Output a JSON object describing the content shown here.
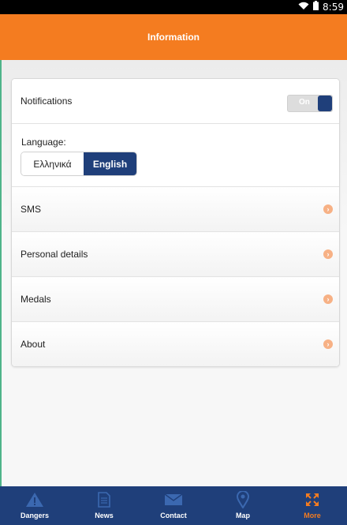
{
  "status_bar": {
    "time": "8:59"
  },
  "header": {
    "title": "Information"
  },
  "settings": {
    "notifications": {
      "label": "Notifications",
      "toggle_text": "On"
    },
    "language": {
      "label": "Language:",
      "options": [
        "Ελληνικά",
        "English"
      ],
      "selected": "English"
    },
    "menu_items": [
      {
        "label": "SMS"
      },
      {
        "label": "Personal details"
      },
      {
        "label": "Medals"
      },
      {
        "label": "About"
      }
    ]
  },
  "bottom_nav": {
    "items": [
      {
        "label": "Dangers",
        "icon": "warning-icon"
      },
      {
        "label": "News",
        "icon": "document-icon"
      },
      {
        "label": "Contact",
        "icon": "envelope-icon"
      },
      {
        "label": "Map",
        "icon": "map-pin-icon"
      },
      {
        "label": "More",
        "icon": "expand-icon",
        "active": true
      }
    ]
  },
  "colors": {
    "header": "#f47c20",
    "nav": "#1f3f7a",
    "active_tab": "#f47c20"
  }
}
